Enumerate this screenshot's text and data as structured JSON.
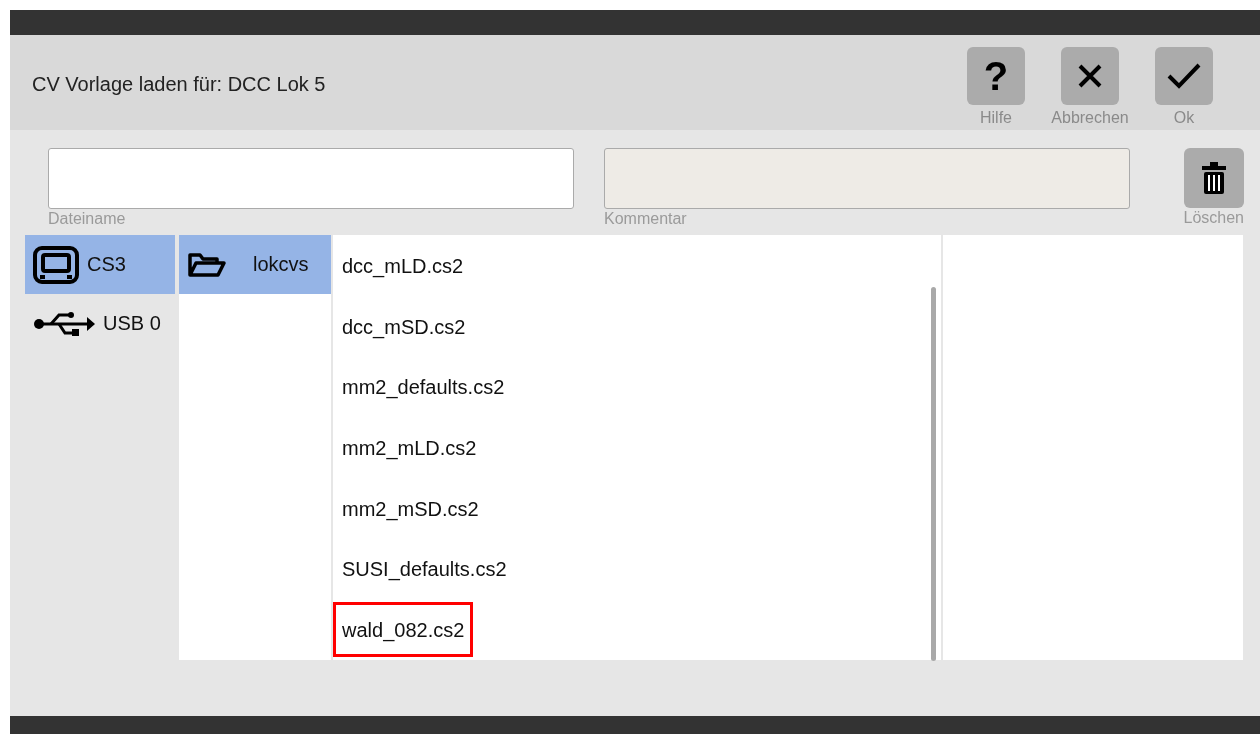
{
  "dialog": {
    "title": "CV Vorlage laden für: DCC Lok 5"
  },
  "header_buttons": [
    {
      "kind": "help",
      "label": "?",
      "caption": "Hilfe"
    },
    {
      "kind": "cancel",
      "caption": "Abbrechen"
    },
    {
      "kind": "ok",
      "caption": "Ok"
    }
  ],
  "fields": {
    "filename": {
      "caption": "Dateiname"
    },
    "comment": {
      "caption": "Kommentar",
      "disabled": true
    },
    "delete": {
      "caption": "Löschen"
    }
  },
  "devices": [
    {
      "kind": "cs3",
      "label": "CS3",
      "selected": true
    },
    {
      "kind": "usb",
      "label": "USB 0",
      "selected": false
    }
  ],
  "folders": [
    {
      "label": "lokcvs",
      "selected": true
    }
  ],
  "files": [
    {
      "name": "dcc_mLD.cs2",
      "highlighted": false
    },
    {
      "name": "dcc_mSD.cs2",
      "highlighted": false
    },
    {
      "name": "mm2_defaults.cs2",
      "highlighted": false
    },
    {
      "name": "mm2_mLD.cs2",
      "highlighted": false
    },
    {
      "name": "mm2_mSD.cs2",
      "highlighted": false
    },
    {
      "name": "SUSI_defaults.cs2",
      "highlighted": false
    },
    {
      "name": "wald_082.cs2",
      "highlighted": true
    }
  ]
}
